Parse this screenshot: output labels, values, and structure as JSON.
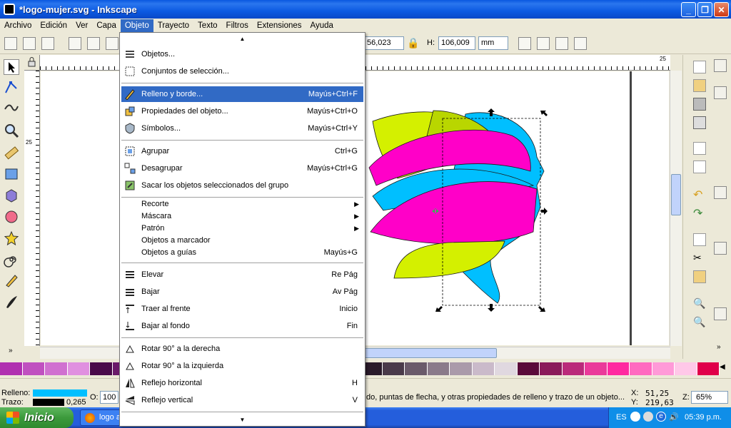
{
  "window": {
    "title": "*logo-mujer.svg - Inkscape"
  },
  "menubar": [
    "Archivo",
    "Edición",
    "Ver",
    "Capa",
    "Objeto",
    "Trayecto",
    "Texto",
    "Filtros",
    "Extensiones",
    "Ayuda"
  ],
  "toolbar": {
    "x_value": "56,023",
    "h_label": "H:",
    "h_value": "106,009",
    "unit": "mm"
  },
  "objeto_menu": {
    "items": [
      {
        "label": "Objetos...",
        "shortcut": ""
      },
      {
        "label": "Conjuntos de selección...",
        "shortcut": ""
      },
      {
        "label": "Relleno y borde...",
        "shortcut": "Mayús+Ctrl+F"
      },
      {
        "label": "Propiedades del objeto...",
        "shortcut": "Mayús+Ctrl+O"
      },
      {
        "label": "Símbolos...",
        "shortcut": "Mayús+Ctrl+Y"
      },
      {
        "label": "Agrupar",
        "shortcut": "Ctrl+G"
      },
      {
        "label": "Desagrupar",
        "shortcut": "Mayús+Ctrl+G"
      },
      {
        "label": "Sacar los objetos seleccionados del grupo",
        "shortcut": ""
      },
      {
        "label": "Recorte",
        "shortcut": ""
      },
      {
        "label": "Máscara",
        "shortcut": ""
      },
      {
        "label": "Patrón",
        "shortcut": ""
      },
      {
        "label": "Objetos a marcador",
        "shortcut": ""
      },
      {
        "label": "Objetos a guías",
        "shortcut": "Mayús+G"
      },
      {
        "label": "Elevar",
        "shortcut": "Re Pág"
      },
      {
        "label": "Bajar",
        "shortcut": "Av Pág"
      },
      {
        "label": "Traer al frente",
        "shortcut": "Inicio"
      },
      {
        "label": "Bajar al fondo",
        "shortcut": "Fin"
      },
      {
        "label": "Rotar 90° a la derecha",
        "shortcut": ""
      },
      {
        "label": "Rotar 90° a la izquierda",
        "shortcut": ""
      },
      {
        "label": "Reflejo horizontal",
        "shortcut": "H"
      },
      {
        "label": "Reflejo vertical",
        "shortcut": "V"
      }
    ]
  },
  "ruler": {
    "tick_25_top": "25",
    "tick_25_right": "25"
  },
  "status": {
    "fill_label": "Relleno:",
    "stroke_label": "Trazo:",
    "stroke_width": "0,265",
    "opacity_label": "O:",
    "opacity_value": "100",
    "message": "do, puntas de flecha, y otras propiedades de relleno y trazo de un objeto...",
    "x_label": "X:",
    "x_value": "51,25",
    "y_label": "Y:",
    "y_value": "219,63",
    "zoom_label": "Z:",
    "zoom_value": "65%"
  },
  "taskbar": {
    "start": "Inicio",
    "task": "logo a",
    "lang": "ES",
    "time": "05:39 p.m."
  },
  "colors": {
    "cyan": "#00bfff",
    "magenta": "#ff00c8",
    "lime": "#d4f000",
    "menu_highlight": "#316ac5"
  }
}
